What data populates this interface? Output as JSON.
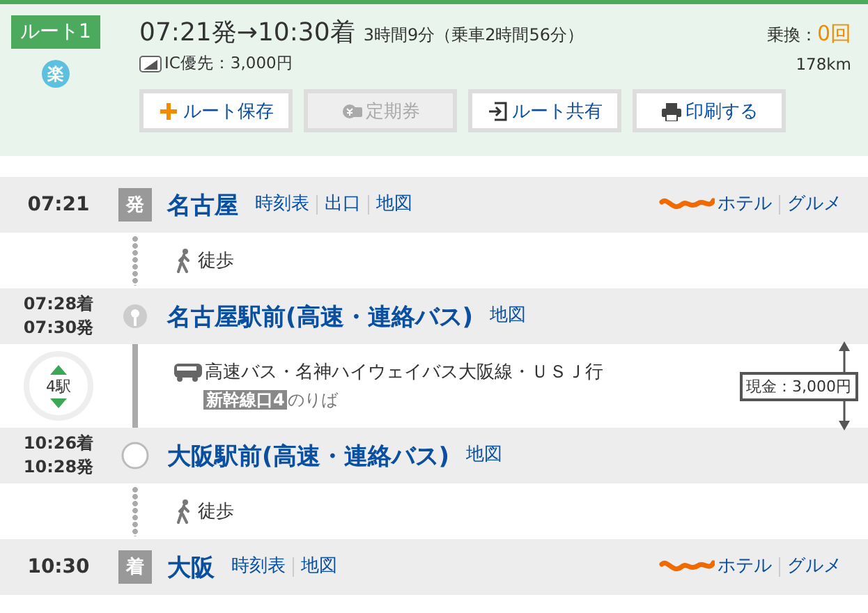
{
  "summary": {
    "route_label": "ルート1",
    "badge": "楽",
    "times": "07:21発→10:30着",
    "duration": "3時間9分（乗車2時間56分）",
    "fare": "IC優先：3,000円",
    "transfers_label": "乗換：",
    "transfers": "0回",
    "distance": "178km",
    "buttons": [
      {
        "label": "ルート保存",
        "kind": "save",
        "disabled": false
      },
      {
        "label": "定期券",
        "kind": "pass",
        "disabled": true
      },
      {
        "label": "ルート共有",
        "kind": "share",
        "disabled": false
      },
      {
        "label": "印刷する",
        "kind": "print",
        "disabled": false
      }
    ]
  },
  "legs": [
    {
      "kind": "station",
      "times": [
        "07:21"
      ],
      "mark": {
        "kind": "badge",
        "text": "発"
      },
      "name": "名古屋",
      "links": [
        "時刻表",
        "出口",
        "地図"
      ],
      "extras": [
        "ホテル",
        "グルメ"
      ]
    },
    {
      "kind": "walk",
      "label": "徒歩"
    },
    {
      "kind": "station",
      "times": [
        "07:28着",
        "07:30発"
      ],
      "mark": {
        "kind": "pin"
      },
      "name": "名古屋駅前(高速・連絡バス)",
      "links": [
        "地図"
      ]
    },
    {
      "kind": "ride",
      "stops": "4駅",
      "line": "高速バス・名神ハイウェイバス大阪線・ＵＳＪ行",
      "platform": "新幹線口4",
      "platform_suffix": "のりば",
      "fare": "現金：3,000円"
    },
    {
      "kind": "station",
      "times": [
        "10:26着",
        "10:28発"
      ],
      "mark": {
        "kind": "circle"
      },
      "name": "大阪駅前(高速・連絡バス)",
      "links": [
        "地図"
      ]
    },
    {
      "kind": "walk",
      "label": "徒歩"
    },
    {
      "kind": "station",
      "times": [
        "10:30"
      ],
      "mark": {
        "kind": "badge",
        "text": "着"
      },
      "name": "大阪",
      "links": [
        "時刻表",
        "地図"
      ],
      "extras": [
        "ホテル",
        "グルメ"
      ]
    }
  ]
}
